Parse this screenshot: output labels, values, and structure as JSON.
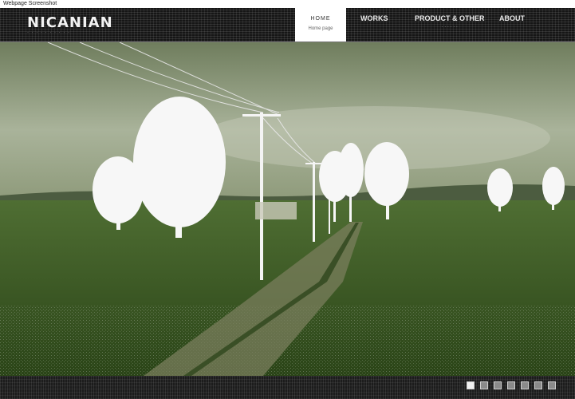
{
  "window": {
    "title": "Webpage Screenshot"
  },
  "header": {
    "logo": "NICANIAN",
    "tagline": "· · · · · · · · · ·"
  },
  "nav": {
    "active": {
      "label": "HOME",
      "sub": "Home page"
    },
    "items": [
      {
        "label": "WORKS",
        "sub": ""
      },
      {
        "label": "PRODUCT & OTHER",
        "sub": "· · · · · ·"
      },
      {
        "label": "ABOUT",
        "sub": ""
      }
    ]
  },
  "slideshow": {
    "image": "rural-road-with-trees-and-power-lines",
    "slide_count": 7,
    "active_slide": 1
  },
  "colors": {
    "header_bg": "#161616",
    "sky": "#9aa58a",
    "field": "#3f5e24",
    "accent": "#ffffff"
  }
}
